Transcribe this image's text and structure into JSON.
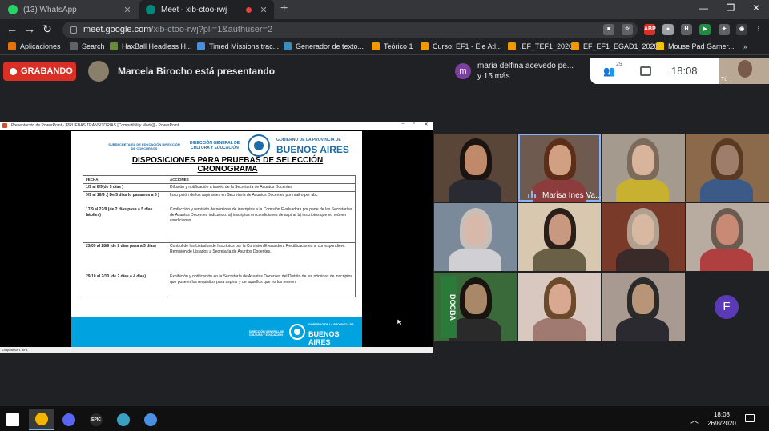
{
  "browser": {
    "tabs": [
      {
        "label": "(13) WhatsApp",
        "active": false,
        "icon": "whatsapp-icon"
      },
      {
        "label": "Meet - xib-ctoo-rwj",
        "active": true,
        "icon": "meet-icon"
      }
    ],
    "new_tab_icon": "+",
    "window_controls": [
      "—",
      "❐",
      "✕"
    ],
    "url_host": "meet.google.com",
    "url_path": "/xib-ctoo-rwj?pli=1&authuser=2",
    "extensions": [
      {
        "icon": "video-icon",
        "text": "■",
        "color": "#5f6368"
      },
      {
        "icon": "star-icon",
        "text": "☆",
        "color": "#5f6368"
      },
      {
        "icon": "abp-icon",
        "text": "ABP",
        "color": "#d93025"
      },
      {
        "icon": "circle-ext-icon",
        "text": "●",
        "color": "#9aa0a6"
      },
      {
        "icon": "h-ext-icon",
        "text": "H",
        "color": "#5f6368"
      },
      {
        "icon": "play-ext-icon",
        "text": "▶",
        "color": "#1e8e3e"
      },
      {
        "icon": "puzzle-icon",
        "text": "✦",
        "color": "#5f6368"
      },
      {
        "icon": "profile-icon",
        "text": "◉",
        "color": "#3c4043"
      },
      {
        "icon": "menu-icon",
        "text": "⋮",
        "color": "#202124"
      }
    ],
    "bookmarks": [
      {
        "label": "Aplicaciones",
        "color": "#e8710a"
      },
      {
        "label": "Search",
        "color": "#5f6368"
      },
      {
        "label": "HaxBall Headless H...",
        "color": "#6a8a3a"
      },
      {
        "label": "Timed Missions trac...",
        "color": "#4a90d9"
      },
      {
        "label": "Generador de texto...",
        "color": "#3c8dbc"
      },
      {
        "label": "Teórico 1",
        "color": "#f29900"
      },
      {
        "label": "Curso: EF1 - Eje Atl...",
        "color": "#f29900"
      },
      {
        "label": ".EF_TEF1_2020",
        "color": "#f29900"
      },
      {
        "label": "EF_EF1_EGAD1_2020",
        "color": "#f29900"
      },
      {
        "label": "Mouse Pad Gamer...",
        "color": "#f4c20d"
      }
    ],
    "bookmarks_more": "»"
  },
  "meet": {
    "recording_label": "GRABANDO",
    "presenting_text": "Marcela Birocho está presentando",
    "notification_initial": "m",
    "notification_line1": "maria delfina acevedo pe...",
    "notification_line2": "y 15 más",
    "participants_count": "29",
    "time": "18:08",
    "self_tag": "Tú",
    "colors": {
      "recording": "#d93025",
      "accent": "#8ab4f8",
      "avatar_f": "#5b3ab8"
    }
  },
  "presentation": {
    "window_title": "Presentación de PowerPoint - [PRUEBAS TRANSITORIAS [Compatibility Mode]] - PowerPoint",
    "status": "Diapositiva 1 de 1",
    "header_sub1": "SUBSECRETARÍA DE EDUCACIÓN DIRECCIÓN DE CONCURSOS",
    "header_sub2": "DIRECCIÓN GENERAL DE CULTURA Y EDUCACIÓN",
    "header_gob": "GOBIERNO DE LA PROVINCIA DE",
    "header_ba": "BUENOS AIRES",
    "title_line1": "DISPOSICIONES PARA PRUEBAS DE SELECCIÓN",
    "title_line2": "CRONOGRAMA",
    "table_headers": [
      "FECHA",
      "ACCIONES"
    ],
    "table_rows": [
      {
        "date": "1/9 al 8/9(de 5 días )",
        "actions": "Difusión y notificación a través de la Secretaría de Asuntos Docentes"
      },
      {
        "date": "9/9 al 16/9 .( De 5 días lo pasamos a 5 )",
        "actions": "Inscripción de los aspirantes en Secretaría de Asuntos Docentes por mail o por abc"
      },
      {
        "date": "17/9 al 22/9 (de 2 días pasa a 5 días hábiles)",
        "actions": "Confección y remisión de nóminas de inscriptos a la Comisión Evaluadora por parte de las Secretarías de Asuntos Docentes indicando: a) inscriptos en condiciones de aspirar b) inscriptos que no reúnen condiciones"
      },
      {
        "date": "23/09 al 28/9 (de 2 días pasa a 3 días)",
        "actions": "Control de los Listados de Inscriptos por la Comisión Evaluadora Rectificaciones si correspondiere. Remisión de Listados a Secretaría de Asuntos Docentes."
      },
      {
        "date": "29/10 al 2/10 (de 2 días a 4 días)",
        "actions": "Exhibición y notificación en la Secretaría de Asuntos Docentes del Distrito de las nóminas de inscriptos que poseen los requisitos para aspirar y de aquellos que no los reúnen"
      }
    ],
    "footer_left": "DIRECCIÓN GENERAL DE CULTURA Y EDUCACIÓN",
    "footer_gob": "GOBIERNO DE LA PROVINCIA DE",
    "footer_ba": "BUENOS AIRES",
    "colors": {
      "brand_blue": "#1b6ca8",
      "footer": "#00a3e0"
    }
  },
  "participants": {
    "speaking_name": "Marisa Ines Va...",
    "avatar_f_initial": "F",
    "tiles": [
      {
        "name": "",
        "bg": "#5a4638",
        "face": "#c08a6a",
        "hair": "#1c1410",
        "body": "#2a2a33"
      },
      {
        "name": "Marisa Ines Va...",
        "bg": "#6e5a4e",
        "face": "#d1a083",
        "hair": "#5c2e1a",
        "body": "#8c3c3c",
        "speaking": true
      },
      {
        "name": "",
        "bg": "#a49b8e",
        "face": "#d8b49c",
        "hair": "#7c6a5a",
        "body": "#c8b030"
      },
      {
        "name": "",
        "bg": "#8a6a4a",
        "face": "#9e7e6a",
        "hair": "#5a3a22",
        "body": "#3c5a88"
      },
      {
        "name": "",
        "bg": "#7a8a9a",
        "face": "#d8b8a8",
        "hair": "#c8c0b8",
        "body": "#d0d0d4"
      },
      {
        "name": "",
        "bg": "#d8c8b0",
        "face": "#c89880",
        "hair": "#2a1e18",
        "body": "#6a6048"
      },
      {
        "name": "",
        "bg": "#7a3a2a",
        "face": "#d8b8a0",
        "hair": "#b0a090",
        "body": "#3a2a2a"
      },
      {
        "name": "",
        "bg": "#b8aca0",
        "face": "#c88a74",
        "hair": "#6a5a50",
        "body": "#b04040"
      },
      {
        "name": "",
        "bg": "#3a6a3a",
        "face": "#a88868",
        "hair": "#1a1410",
        "body": "#2a2a2a",
        "flag_text": "DOCBA"
      },
      {
        "name": "",
        "bg": "#d8c8c0",
        "face": "#d8a890",
        "hair": "#6a4a2a",
        "body": "#a07a70"
      },
      {
        "name": "",
        "bg": "#a89a90",
        "face": "#b89478",
        "hair": "#2a2a2a",
        "body": "#2a2a30"
      },
      {
        "name": "",
        "bg": "#202124",
        "avatar": true
      }
    ]
  },
  "taskbar": {
    "time": "18:08",
    "date": "26/8/2020",
    "apps": [
      {
        "icon": "windows-start-icon"
      },
      {
        "icon": "chrome-icon",
        "active": true
      },
      {
        "icon": "discord-icon"
      },
      {
        "icon": "epic-games-icon",
        "text": "EPIC"
      },
      {
        "icon": "globe-app-icon"
      },
      {
        "icon": "search-app-icon"
      }
    ]
  }
}
